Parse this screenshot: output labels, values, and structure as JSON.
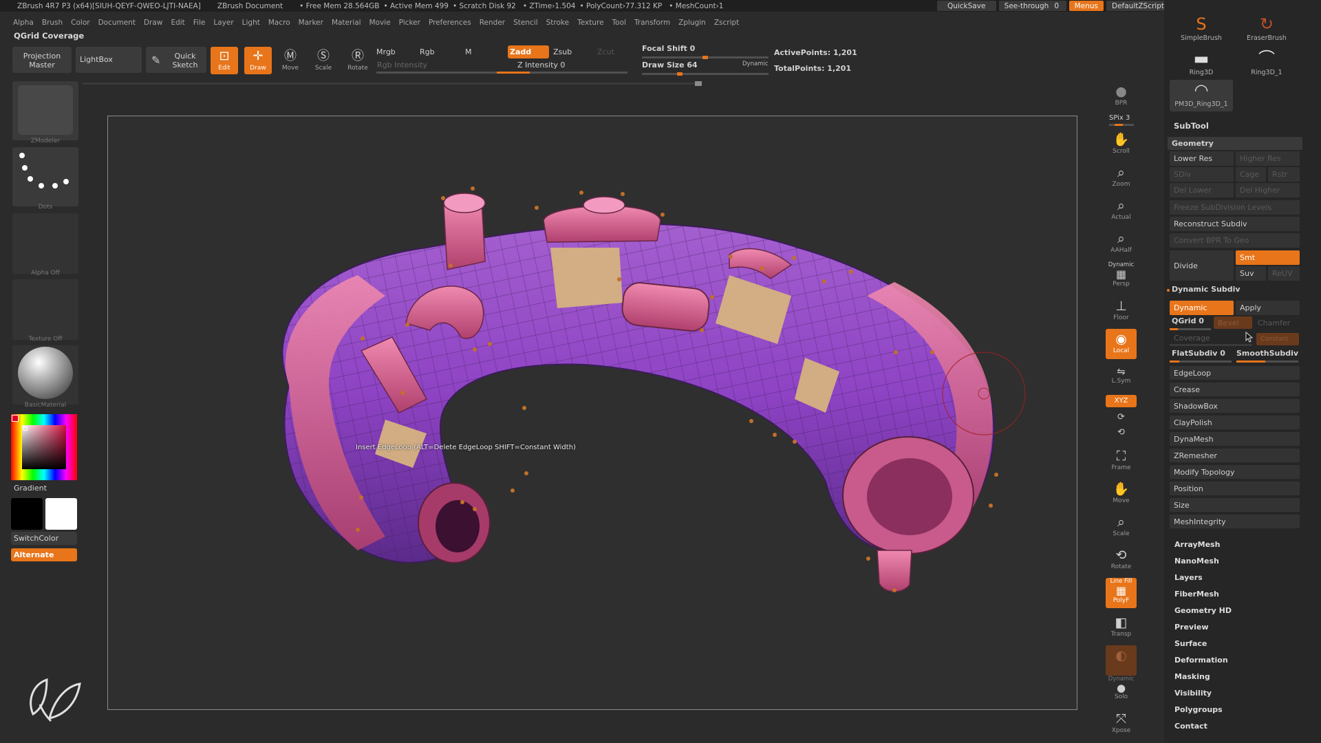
{
  "titlebar": {
    "app": "ZBrush 4R7 P3 (x64)[SIUH-QEYF-QWEO-LJTI-NAEA]",
    "document": "ZBrush Document",
    "free_mem": "• Free Mem 28.564GB",
    "active_mem": "• Active Mem 499",
    "scratch": "• Scratch Disk 92",
    "ztime": "• ZTime›1.504",
    "polycount": "• PolyCount›77.312 KP",
    "meshcount": "• MeshCount›1",
    "quicksave": "QuickSave",
    "seethrough": "See-through",
    "seethrough_val": "0",
    "menus": "Menus",
    "script": "DefaultZScript"
  },
  "menubar": [
    "Alpha",
    "Brush",
    "Color",
    "Document",
    "Draw",
    "Edit",
    "File",
    "Layer",
    "Light",
    "Macro",
    "Marker",
    "Material",
    "Movie",
    "Picker",
    "Preferences",
    "Render",
    "Stencil",
    "Stroke",
    "Texture",
    "Tool",
    "Transform",
    "Zplugin",
    "Zscript"
  ],
  "active_tool_label": "QGrid Coverage",
  "toolbar": {
    "projection_master": "Projection Master",
    "lightbox": "LightBox",
    "quick_sketch": "Quick Sketch",
    "edit": "Edit",
    "draw": "Draw",
    "move": "Move",
    "scale": "Scale",
    "rotate": "Rotate",
    "mrgb": "Mrgb",
    "rgb": "Rgb",
    "m": "M",
    "rgb_intensity": "Rgb Intensity",
    "zadd": "Zadd",
    "zsub": "Zsub",
    "zcut": "Zcut",
    "z_intensity": "Z Intensity 0",
    "z_intensity_value": 0.25,
    "focal_shift": "Focal Shift 0",
    "focal_shift_value": 0.5,
    "draw_size": "Draw Size 64",
    "draw_size_value": 0.3,
    "dynamic": "Dynamic",
    "active_points": "ActivePoints: 1,201",
    "total_points": "TotalPoints: 1,201"
  },
  "left_tray": {
    "zmodeler": "ZModeler",
    "dots": "Dots",
    "alpha": "Alpha Off",
    "texture": "Texture Off",
    "material": "BasicMaterial",
    "gradient": "Gradient",
    "switchcolor": "SwitchColor",
    "alternate": "Alternate",
    "colors": {
      "primary": "#000000",
      "secondary": "#ffffff",
      "accent": "#e8751a"
    }
  },
  "viewport": {
    "tooltip": "Insert EdgeLoop (ALT=Delete EdgeLoop SHIFT=Constant Width)"
  },
  "right_shelf": {
    "bpr": "BPR",
    "spix": "SPix 3",
    "scroll": "Scroll",
    "zoom": "Zoom",
    "actual": "Actual",
    "aahalf": "AAHalf",
    "dynamic_persp": "Dynamic",
    "persp": "Persp",
    "floor": "Floor",
    "local": "Local",
    "lsym": "L.Sym",
    "xyz": "XYZ",
    "frame": "Frame",
    "move": "Move",
    "scale": "Scale",
    "rotate": "Rotate",
    "linefill": "Line Fill",
    "polyf": "PolyF",
    "transp": "Transp",
    "dynamic_solo": "Dynamic",
    "solo": "Solo",
    "xpose": "Xpose"
  },
  "right_panel": {
    "brushes": [
      "SimpleBrush",
      "EraserBrush",
      "Ring3D",
      "Ring3D_1",
      "PM3D_Ring3D_1"
    ],
    "subtool": "SubTool",
    "geometry": "Geometry",
    "lower_res": "Lower Res",
    "higher_res": "Higher Res",
    "sdiv": "SDiv",
    "cage": "Cage",
    "rstr": "Rstr",
    "del_lower": "Del Lower",
    "del_higher": "Del Higher",
    "freeze": "Freeze SubDivision Levels",
    "reconstruct": "Reconstruct Subdiv",
    "convert_bpr": "Convert BPR To Geo",
    "divide": "Divide",
    "smt": "Smt",
    "suv": "Suv",
    "reuv": "ReUV",
    "dynamic_subdiv": "Dynamic Subdiv",
    "dynamic": "Dynamic",
    "apply": "Apply",
    "qgrid": "QGrid 0",
    "bevel": "Bevel",
    "chamfer": "Chamfer",
    "coverage": "Coverage",
    "constant": "Constant",
    "flatsubdiv": "FlatSubdiv 0",
    "smoothsubdiv": "SmoothSubdiv",
    "geometry_items": [
      "EdgeLoop",
      "Crease",
      "ShadowBox",
      "ClayPolish",
      "DynaMesh",
      "ZRemesher",
      "Modify Topology",
      "Position",
      "Size",
      "MeshIntegrity"
    ],
    "tool_sections": [
      "ArrayMesh",
      "NanoMesh",
      "Layers",
      "FiberMesh",
      "Geometry HD",
      "Preview",
      "Surface",
      "Deformation",
      "Masking",
      "Visibility",
      "Polygroups",
      "Contact"
    ]
  }
}
